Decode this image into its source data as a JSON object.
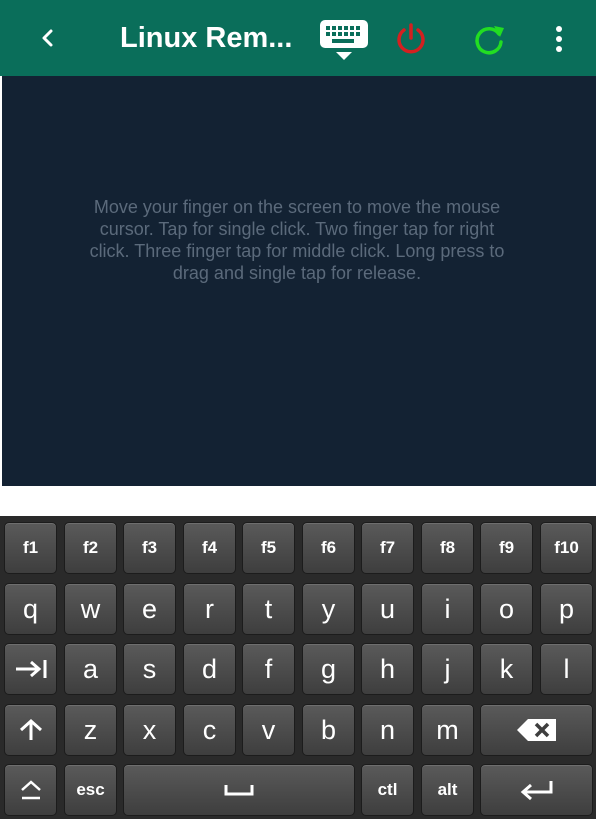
{
  "toolbar": {
    "title": "Linux Rem...",
    "icons": {
      "back": "chevron-left-icon",
      "keyboard": "keyboard-hide-icon",
      "power": "power-icon",
      "refresh": "refresh-icon",
      "menu": "overflow-menu-icon"
    },
    "colors": {
      "background": "#0a6e5a",
      "power": "#d42020",
      "refresh": "#22dd22"
    }
  },
  "touchpad": {
    "hint": "Move your finger on the screen to move the mouse cursor. Tap for single click. Two finger tap for right click. Three finger tap for middle click. Long press to drag and single tap for release.",
    "background": "#132233"
  },
  "keyboard": {
    "row1": [
      "f1",
      "f2",
      "f3",
      "f4",
      "f5",
      "f6",
      "f7",
      "f8",
      "f9",
      "f10"
    ],
    "row2": [
      "q",
      "w",
      "e",
      "r",
      "t",
      "y",
      "u",
      "i",
      "o",
      "p"
    ],
    "row3": [
      "a",
      "s",
      "d",
      "f",
      "g",
      "h",
      "j",
      "k",
      "l"
    ],
    "row4": [
      "z",
      "x",
      "c",
      "v",
      "b",
      "n",
      "m"
    ],
    "row5": {
      "esc": "esc",
      "ctl": "ctl",
      "alt": "alt"
    },
    "icons": {
      "tab": "tab-icon",
      "shift": "shift-icon",
      "backspace": "backspace-icon",
      "capslock": "caps-lock-icon",
      "space": "space-icon",
      "enter": "enter-icon"
    }
  }
}
